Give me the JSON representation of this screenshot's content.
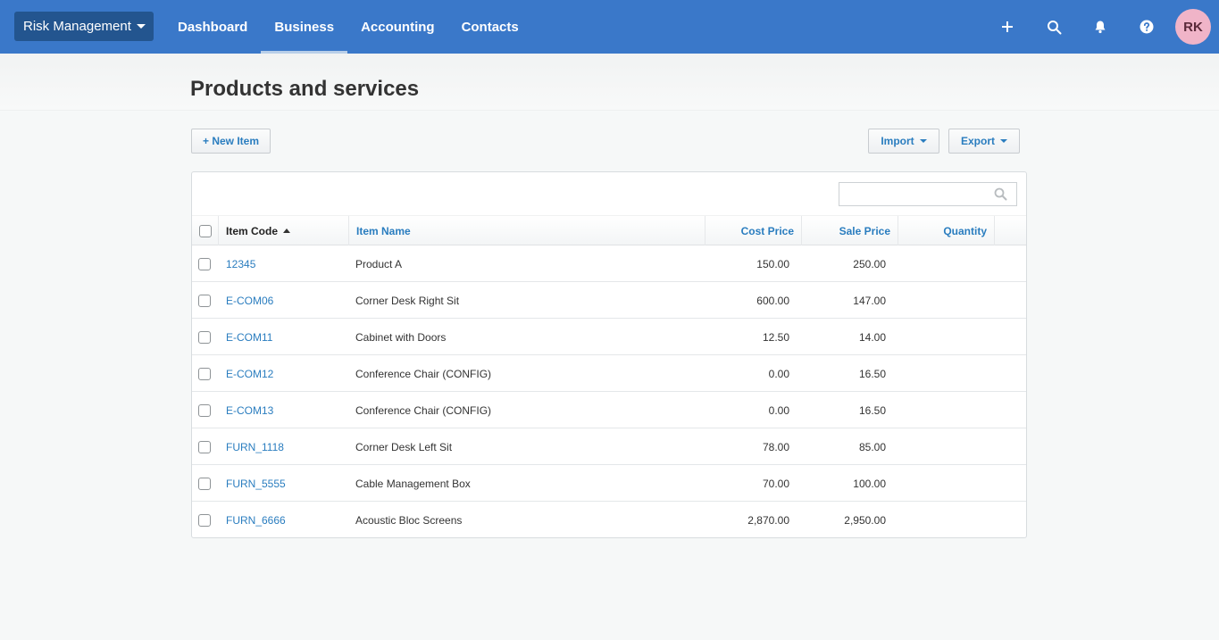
{
  "topbar": {
    "org_label": "Risk Management",
    "nav": [
      {
        "label": "Dashboard",
        "active": false
      },
      {
        "label": "Business",
        "active": true
      },
      {
        "label": "Accounting",
        "active": false
      },
      {
        "label": "Contacts",
        "active": false
      }
    ],
    "icons": [
      "plus-icon",
      "search-icon",
      "bell-icon",
      "help-icon"
    ],
    "avatar_initials": "RK",
    "bar_color": "#3a78c9",
    "avatar_color": "#f0b4c8"
  },
  "page": {
    "title": "Products and services"
  },
  "toolbar": {
    "new_item_label": "+ New Item",
    "import_label": "Import",
    "export_label": "Export"
  },
  "search": {
    "placeholder": ""
  },
  "table": {
    "columns": [
      {
        "label": "Item Code",
        "sorted": "asc"
      },
      {
        "label": "Item Name"
      },
      {
        "label": "Cost Price"
      },
      {
        "label": "Sale Price"
      },
      {
        "label": "Quantity"
      }
    ],
    "rows": [
      {
        "code": "12345",
        "name": "Product A",
        "cost": "150.00",
        "sale": "250.00",
        "qty": ""
      },
      {
        "code": "E-COM06",
        "name": "Corner Desk Right Sit",
        "cost": "600.00",
        "sale": "147.00",
        "qty": ""
      },
      {
        "code": "E-COM11",
        "name": "Cabinet with Doors",
        "cost": "12.50",
        "sale": "14.00",
        "qty": ""
      },
      {
        "code": "E-COM12",
        "name": "Conference Chair (CONFIG)",
        "cost": "0.00",
        "sale": "16.50",
        "qty": ""
      },
      {
        "code": "E-COM13",
        "name": "Conference Chair (CONFIG)",
        "cost": "0.00",
        "sale": "16.50",
        "qty": ""
      },
      {
        "code": "FURN_1118",
        "name": "Corner Desk Left Sit",
        "cost": "78.00",
        "sale": "85.00",
        "qty": ""
      },
      {
        "code": "FURN_5555",
        "name": "Cable Management Box",
        "cost": "70.00",
        "sale": "100.00",
        "qty": ""
      },
      {
        "code": "FURN_6666",
        "name": "Acoustic Bloc Screens",
        "cost": "2,870.00",
        "sale": "2,950.00",
        "qty": ""
      }
    ]
  }
}
